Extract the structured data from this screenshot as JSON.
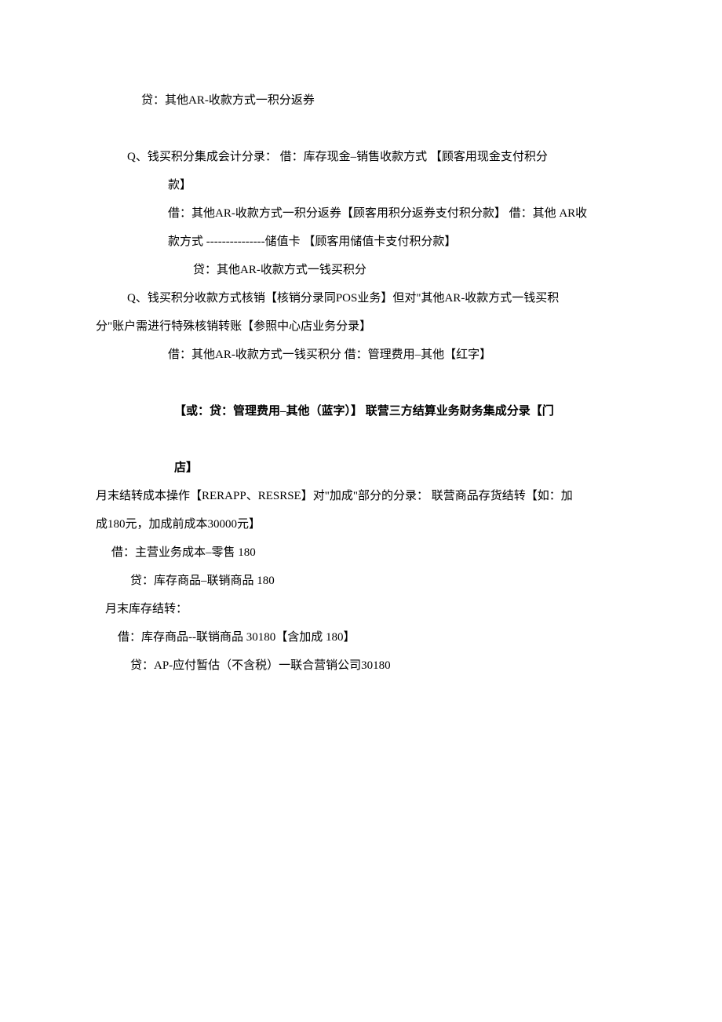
{
  "lines": {
    "l1": "贷：其他AR-收款方式一积分返券",
    "l2": "Q、钱买积分集成会计分录：  借：库存现金–销售收款方式   【顾客用现金支付积分",
    "l3": "款】",
    "l4": "借：其他AR-收款方式一积分返券【顾客用积分返券支付积分款】  借：其他  AR收",
    "l5": "款方式 ---------------储值卡 【顾客用储值卡支付积分款】",
    "l6": "贷：其他AR-收款方式一钱买积分",
    "l7": "Q、钱买积分收款方式核销【核销分录同POS业务】但对\"其他AR-收款方式一钱买积",
    "l8": "分\"账户需进行特殊核销转账【参照中心店业务分录】",
    "l9": "借：其他AR-收款方式一钱买积分  借：管理费用–其他【红字】",
    "l10a": "【或：贷：管理费用–其他（蓝字）】",
    "l10b": " 联营三方结算业务财务集成分录【门",
    "l11": "店】",
    "l12": "月末结转成本操作【RERAPP、RESRSE】对\"加成\"部分的分录：  联营商品存货结转【如：加",
    "l13": "成180元，加成前成本30000元】",
    "l14": "借：主营业务成本–零售  180",
    "l15": "贷：库存商品–联销商品  180",
    "l16": "月末库存结转：",
    "l17": "借：库存商品--联销商品  30180【含加成  180】",
    "l18": "贷：AP-应付暂估（不含税）一联合营销公司30180"
  }
}
